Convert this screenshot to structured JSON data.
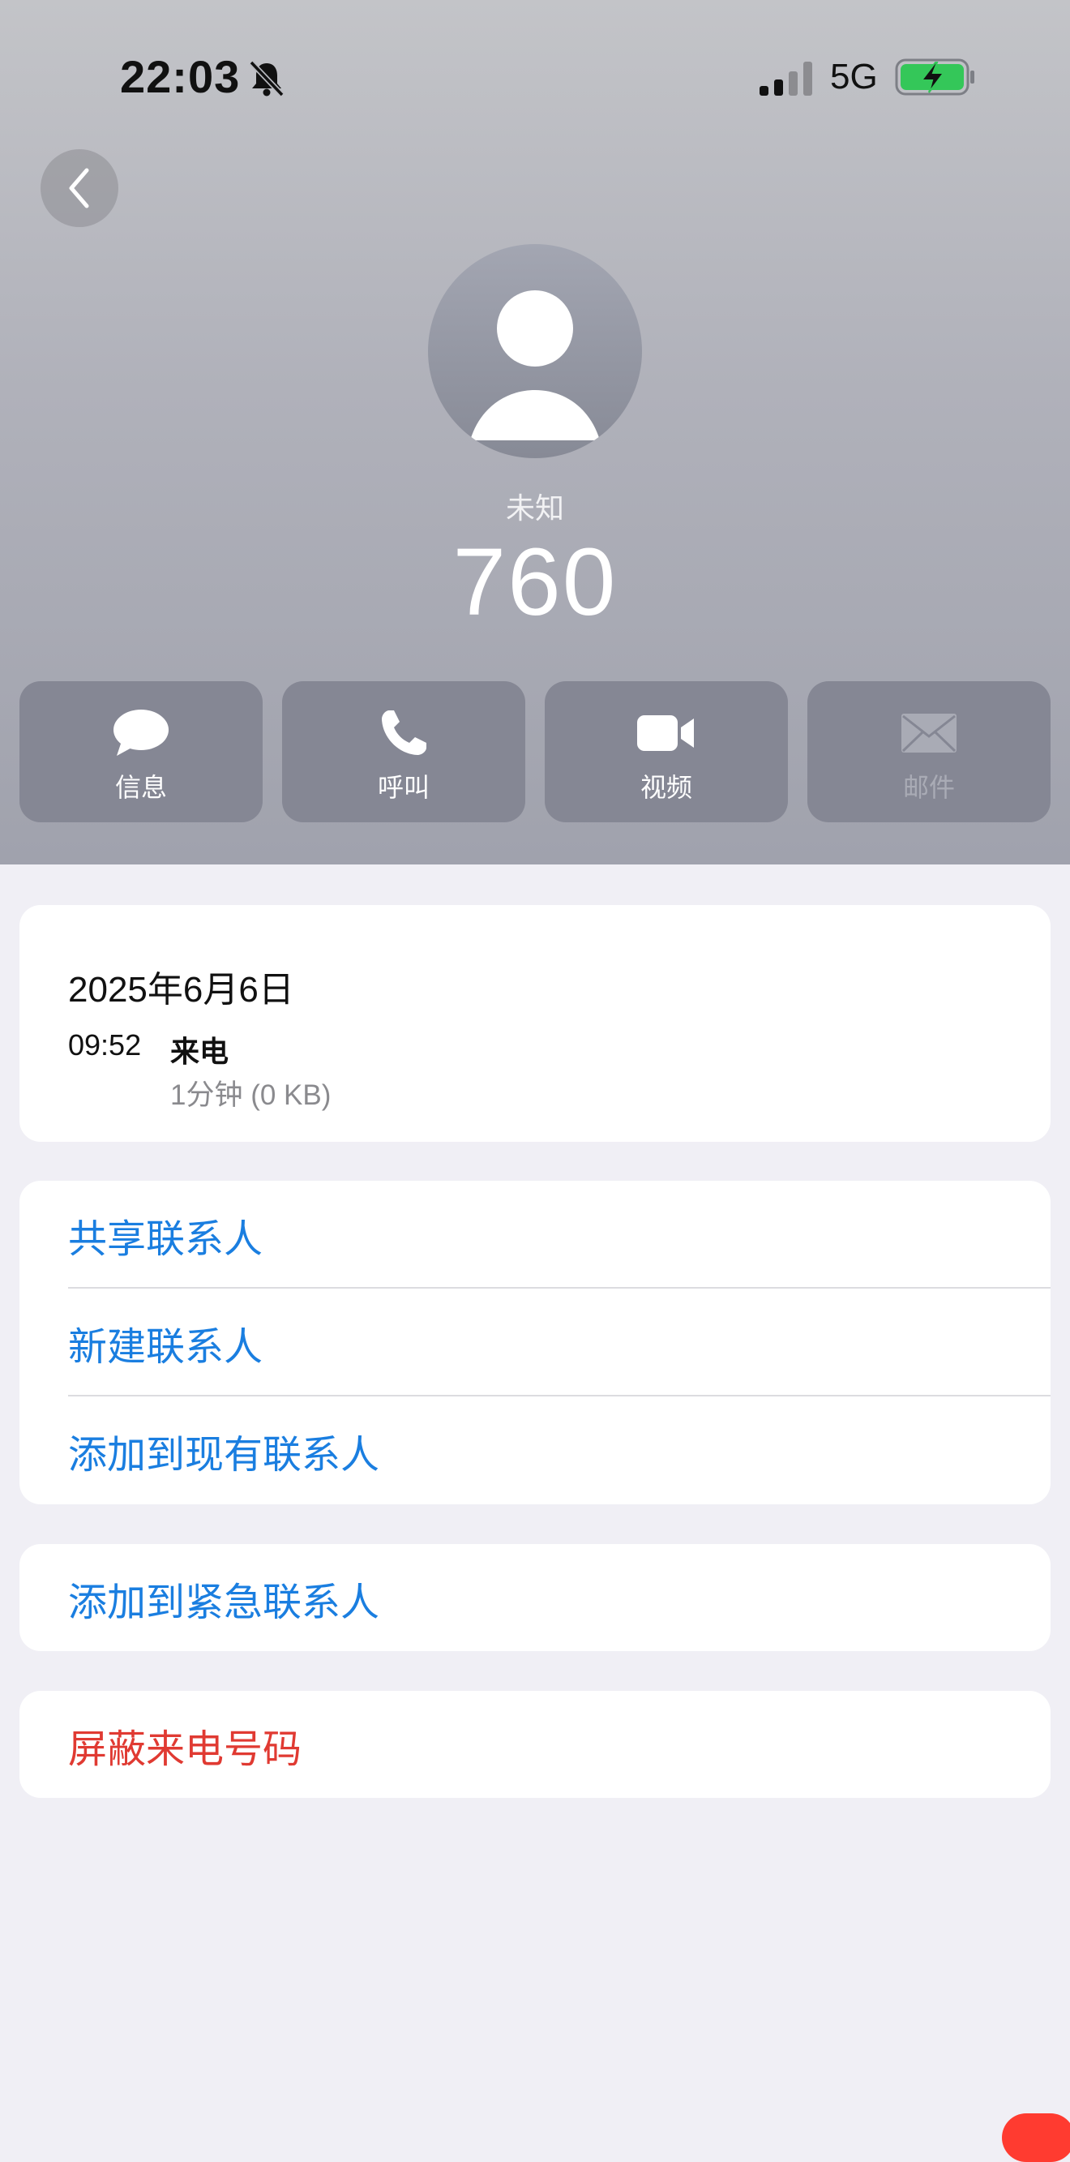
{
  "status_bar": {
    "time": "22:03",
    "network": "5G",
    "icons": [
      "bell-slash-icon",
      "signal-icon",
      "battery-charging-icon"
    ],
    "battery_color": "#34c759"
  },
  "nav": {
    "back_icon": "chevron-left-icon"
  },
  "contact": {
    "label": "未知",
    "number": "760"
  },
  "actions": [
    {
      "label": "信息",
      "icon": "message-icon",
      "enabled": true
    },
    {
      "label": "呼叫",
      "icon": "phone-icon",
      "enabled": true
    },
    {
      "label": "视频",
      "icon": "video-icon",
      "enabled": true
    },
    {
      "label": "邮件",
      "icon": "mail-icon",
      "enabled": false
    }
  ],
  "call_info": {
    "date": "2025年6月6日",
    "time": "09:52",
    "type": "来电",
    "duration": "1分钟 (0 KB)"
  },
  "contact_options": {
    "share": "共享联系人",
    "new": "新建联系人",
    "add_existing": "添加到现有联系人"
  },
  "emergency": {
    "label": "添加到紧急联系人"
  },
  "block": {
    "label": "屏蔽来电号码"
  },
  "colors": {
    "link_blue": "#1a7ee0",
    "destructive_red": "#e03a32",
    "action_button": "#858794"
  }
}
